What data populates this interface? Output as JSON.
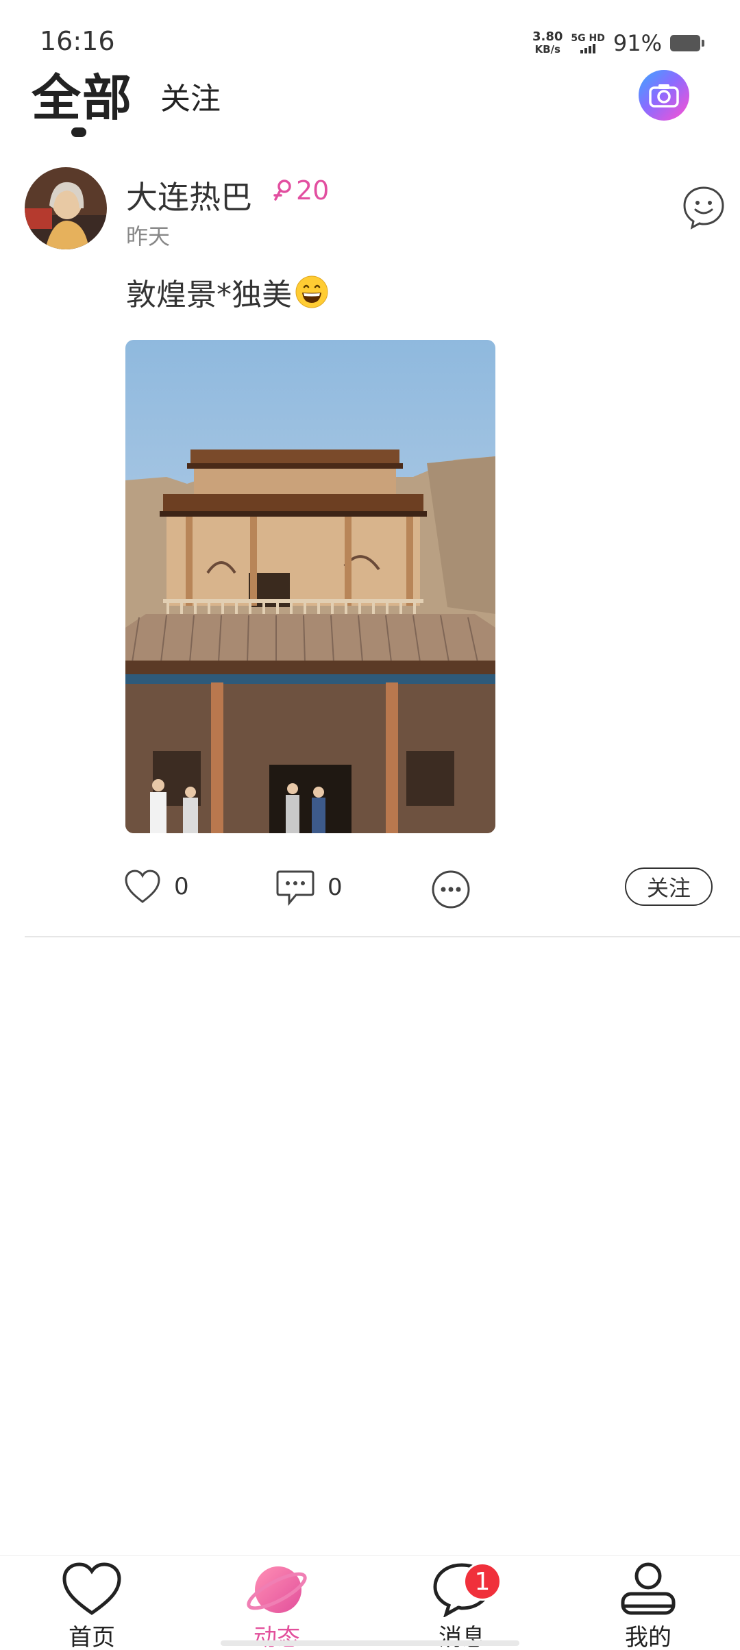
{
  "status_bar": {
    "time": "16:16",
    "net_speed_value": "3.80",
    "net_speed_unit": "KB/s",
    "network_type": "5G HD",
    "battery_percent": "91%"
  },
  "header": {
    "tab_all": "全部",
    "tab_follow": "关注",
    "camera_icon": "camera-icon"
  },
  "post": {
    "username": "大连热巴",
    "level": "20",
    "level_icon": "female-icon",
    "time": "昨天",
    "text": "敦煌景*独美",
    "emoji": "grinning-face",
    "likes": "0",
    "comments": "0",
    "follow_label": "关注"
  },
  "bottom_nav": {
    "items": [
      {
        "label": "首页",
        "icon": "heart-icon"
      },
      {
        "label": "动态",
        "icon": "planet-icon",
        "active": true
      },
      {
        "label": "消息",
        "icon": "chat-bubble-icon",
        "badge": "1"
      },
      {
        "label": "我的",
        "icon": "user-icon"
      }
    ]
  },
  "colors": {
    "accent": "#e24f9b",
    "badge": "#f0303b",
    "text": "#222222"
  }
}
